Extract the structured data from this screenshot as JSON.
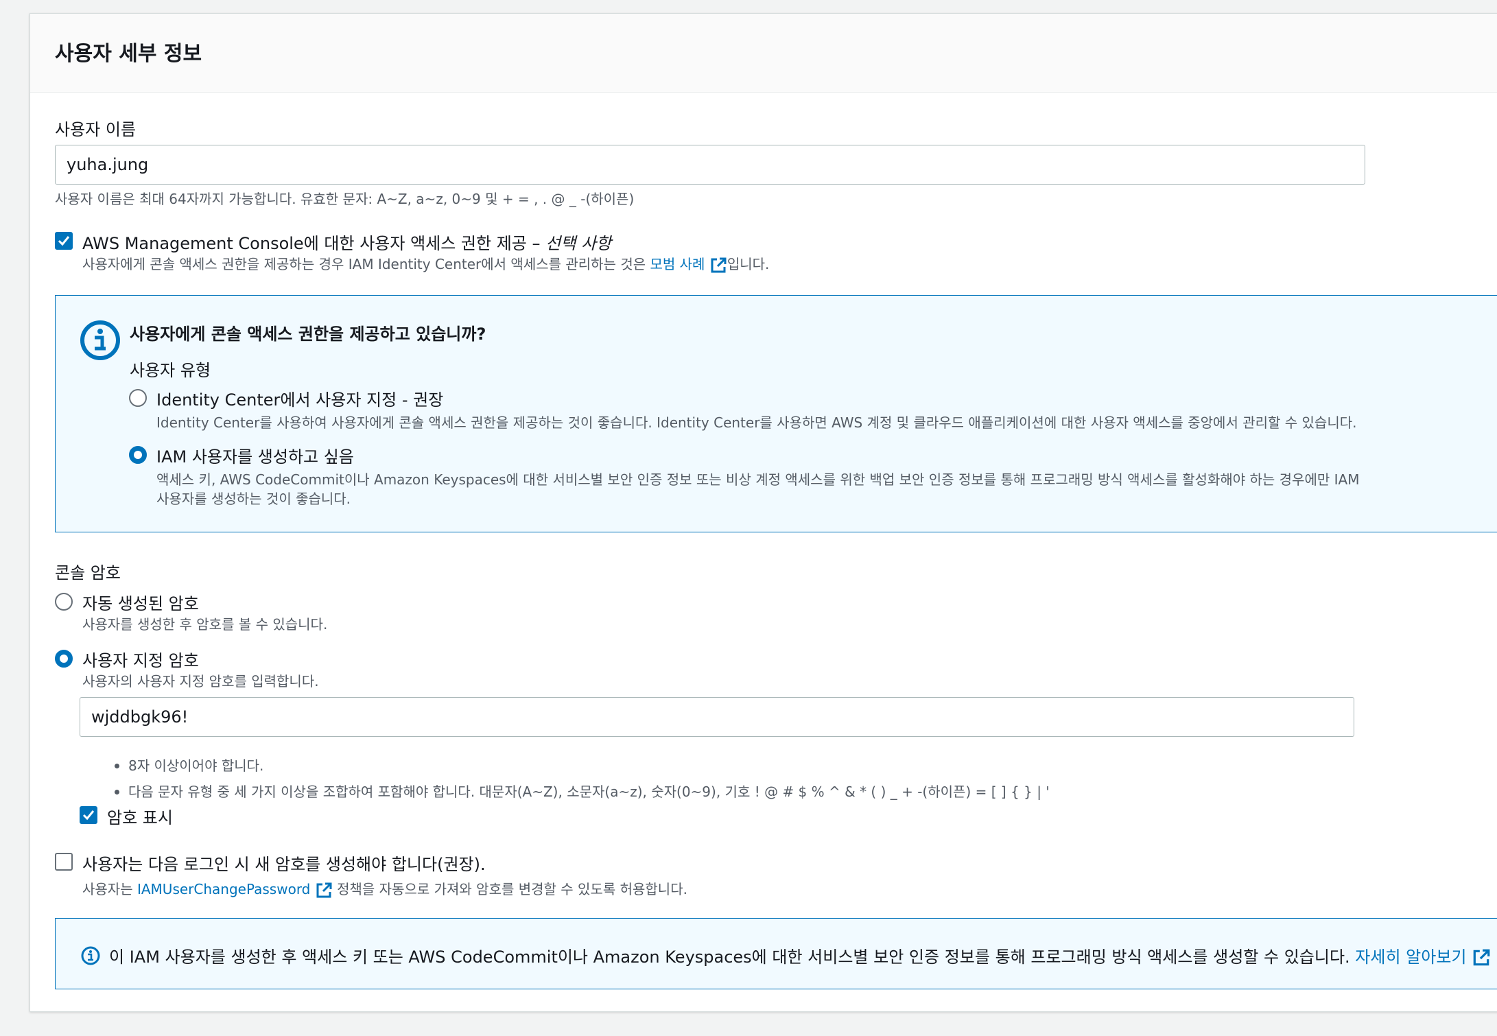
{
  "section_title": "사용자 세부 정보",
  "username": {
    "label": "사용자 이름",
    "value": "yuha.jung",
    "hint": "사용자 이름은 최대 64자까지 가능합니다. 유효한 문자: A~Z, a~z, 0~9 및 + = , . @ _ -(하이픈)"
  },
  "console_access": {
    "checked": true,
    "label_main": "AWS Management Console에 대한 사용자 액세스 권한 제공 – ",
    "label_optional": "선택 사항",
    "desc_before": "사용자에게 콘솔 액세스 권한을 제공하는 경우 IAM Identity Center에서 액세스를 관리하는 것은 ",
    "desc_link": "모범 사례",
    "desc_after": "입니다."
  },
  "info_panel": {
    "icon": "info-icon",
    "title": "사용자에게 콘솔 액세스 권한을 제공하고 있습니까?",
    "user_type_label": "사용자 유형",
    "option_identity_center": {
      "label": "Identity Center에서 사용자 지정 - 권장",
      "desc": "Identity Center를 사용하여 사용자에게 콘솔 액세스 권한을 제공하는 것이 좋습니다. Identity Center를 사용하면 AWS 계정 및 클라우드 애플리케이션에 대한 사용자 액세스를 중앙에서 관리할 수 있습니다.",
      "selected": false
    },
    "option_iam_user": {
      "label": "IAM 사용자를 생성하고 싶음",
      "desc_line1": "액세스 키, AWS CodeCommit이나 Amazon Keyspaces에 대한 서비스별 보안 인증 정보 또는 비상 계정 액세스를 위한 백업 보안 인증 정보를 통해 프로그래밍 방식 액세스를 활성화해야 하는 경우에만 IAM",
      "desc_line2": "사용자를 생성하는 것이 좋습니다.",
      "selected": true
    }
  },
  "console_password": {
    "label": "콘솔 암호",
    "option_auto": {
      "label": "자동 생성된 암호",
      "desc": "사용자를 생성한 후 암호를 볼 수 있습니다.",
      "selected": false
    },
    "option_custom": {
      "label": "사용자 지정 암호",
      "desc": "사용자의 사용자 지정 암호를 입력합니다.",
      "selected": true
    },
    "password_value": "wjddbgk96!",
    "rules": [
      "8자 이상이어야 합니다.",
      "다음 문자 유형 중 세 가지 이상을 조합하여 포함해야 합니다. 대문자(A~Z), 소문자(a~z), 숫자(0~9), 기호 ! @ # $ % ^ & * ( ) _ + -(하이픈) = [ ] { } | '"
    ],
    "show_password_label": "암호 표시",
    "show_password_checked": true
  },
  "reset_password": {
    "checked": false,
    "label": "사용자는 다음 로그인 시 새 암호를 생성해야 합니다(권장).",
    "desc_before": "사용자는 ",
    "desc_link": "IAMUserChangePassword",
    "desc_after": " 정책을 자동으로 가져와 암호를 변경할 수 있도록 허용합니다."
  },
  "bottom_info": {
    "icon": "info-icon",
    "text": "이 IAM 사용자를 생성한 후 액세스 키 또는 AWS CodeCommit이나 Amazon Keyspaces에 대한 서비스별 보안 인증 정보를 통해 프로그래밍 방식 액세스를 생성할 수 있습니다. ",
    "link": "자세히 알아보기"
  },
  "colors": {
    "accent": "#0073bb",
    "info_bg": "#f1faff",
    "text": "#16191f",
    "muted": "#545b64"
  }
}
